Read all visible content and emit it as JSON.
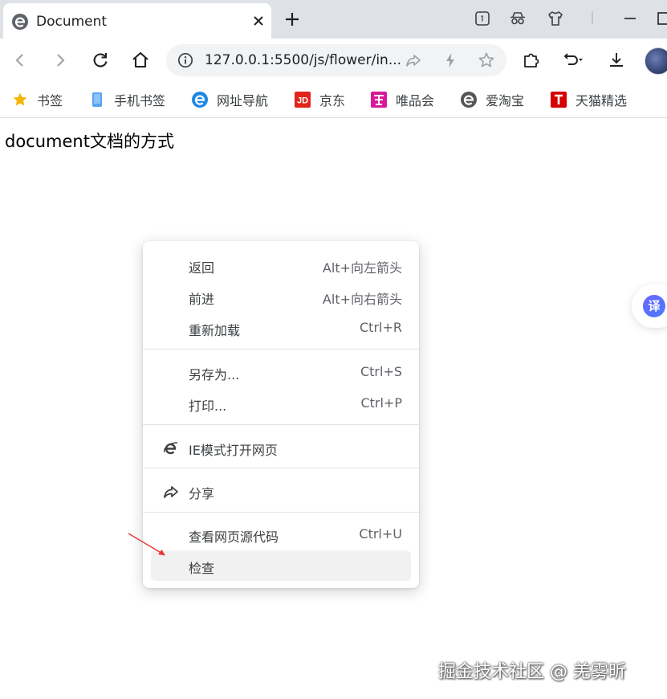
{
  "tab": {
    "title": "Document"
  },
  "toolbar": {
    "url": "127.0.0.1:5500/js/flower/in..."
  },
  "bookmarks": [
    {
      "label": "书签",
      "icon": "star-icon",
      "color": "#f7b500"
    },
    {
      "label": "手机书签",
      "icon": "phone-icon",
      "color": "#5aa3f0"
    },
    {
      "label": "网址导航",
      "icon": "edge-e-icon",
      "color": "#1e88e5"
    },
    {
      "label": "京东",
      "icon": "jd-logo-icon",
      "color": "#e1251b"
    },
    {
      "label": "唯品会",
      "icon": "vip-logo-icon",
      "color": "#d6199a"
    },
    {
      "label": "爱淘宝",
      "icon": "taobao-e-icon",
      "color": "#555555"
    },
    {
      "label": "天猫精选",
      "icon": "tmall-logo-icon",
      "color": "#d50000"
    }
  ],
  "page": {
    "heading": "document文档的方式"
  },
  "context_menu": {
    "items": [
      {
        "label": "返回",
        "shortcut": "Alt+向左箭头"
      },
      {
        "label": "前进",
        "shortcut": "Alt+向右箭头"
      },
      {
        "label": "重新加载",
        "shortcut": "Ctrl+R"
      },
      {
        "label": "另存为...",
        "shortcut": "Ctrl+S"
      },
      {
        "label": "打印...",
        "shortcut": "Ctrl+P"
      },
      {
        "label": "IE模式打开网页",
        "shortcut": "",
        "icon": "ie-icon"
      },
      {
        "label": "分享",
        "shortcut": "",
        "icon": "share-arrow-icon"
      },
      {
        "label": "查看网页源代码",
        "shortcut": "Ctrl+U"
      },
      {
        "label": "检查",
        "shortcut": "",
        "highlighted": true
      }
    ]
  },
  "translate": {
    "glyph": "译"
  },
  "watermark": "掘金技术社区 @ 羌雾昕",
  "colors": {
    "tabstrip": "#dee1e6",
    "omnibox": "#f1f3f4",
    "hover": "#f1f1f1",
    "annotation": "#e53935"
  }
}
